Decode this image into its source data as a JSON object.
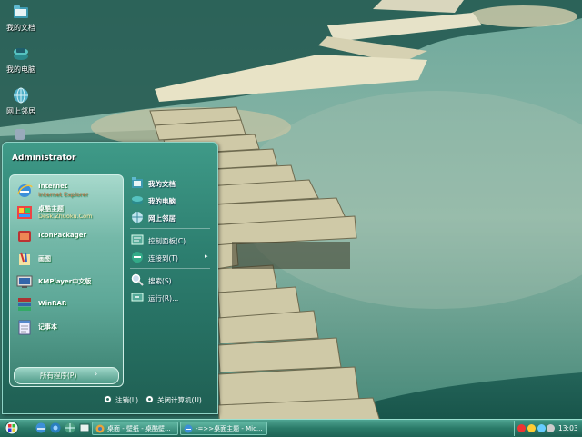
{
  "desktop": {
    "icons": [
      {
        "label": "我的文档",
        "icon": "folder-icon"
      },
      {
        "label": "我的电脑",
        "icon": "computer-icon"
      },
      {
        "label": "网上邻居",
        "icon": "network-icon"
      }
    ]
  },
  "start_menu": {
    "user": "Administrator",
    "programs": [
      {
        "name": "Internet",
        "sub": "Internet Explorer",
        "icon": "ie-icon"
      },
      {
        "name": "桌酷主题",
        "sub": "Desk.Zhuoku.Com",
        "icon": "theme-icon"
      },
      {
        "name": "IconPackager",
        "sub": "",
        "icon": "iconpackager-icon"
      },
      {
        "name": "画图",
        "sub": "",
        "icon": "paint-icon"
      },
      {
        "name": "KMPlayer中文版",
        "sub": "",
        "icon": "kmplayer-icon"
      },
      {
        "name": "WinRAR",
        "sub": "",
        "icon": "winrar-icon"
      },
      {
        "name": "记事本",
        "sub": "",
        "icon": "notepad-icon"
      }
    ],
    "all_programs": "所有程序(P)",
    "places": [
      {
        "label": "我的文档",
        "icon": "documents-icon"
      },
      {
        "label": "我的电脑",
        "icon": "computer-icon"
      },
      {
        "label": "网上邻居",
        "icon": "network-icon"
      }
    ],
    "settings": [
      {
        "label": "控制面板(C)",
        "icon": "control-panel-icon"
      },
      {
        "label": "连接到(T)",
        "icon": "connect-icon",
        "submenu": true
      }
    ],
    "actions": [
      {
        "label": "搜索(S)",
        "icon": "search-icon"
      },
      {
        "label": "运行(R)...",
        "icon": "run-icon"
      }
    ],
    "logoff": "注销(L)",
    "shutdown": "关闭计算机(U)"
  },
  "taskbar": {
    "tasks": [
      {
        "label": "桌面 - 壁纸 - 桌酷壁...",
        "icon": "browser-icon"
      },
      {
        "label": "-=>>桌面主题 - Mic...",
        "icon": "ie-icon"
      }
    ],
    "clock": "13:03"
  },
  "colors": {
    "accent": "#2d7f70",
    "taskbar": "#2a7a68",
    "water": "#2f7466"
  }
}
